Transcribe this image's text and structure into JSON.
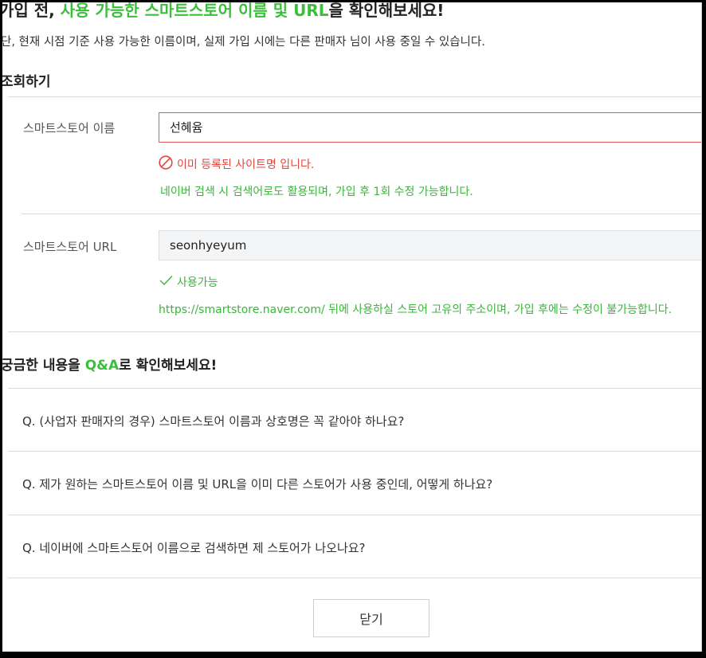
{
  "header": {
    "title_prefix": "가입 전, ",
    "title_highlight": "사용 가능한 스마트스토어 이름 및 URL",
    "title_suffix": "을 확인해보세요!",
    "notice": "단, 현재 시점 기준 사용 가능한 이름이며, 실제 가입 시에는 다른 판매자 님이 사용 중일 수 있습니다."
  },
  "lookup": {
    "heading": "조회하기",
    "name": {
      "label": "스마트스토어 이름",
      "value": "선혜윰",
      "error": "이미 등록된 사이트명 입니다.",
      "help": "네이버 검색 시 검색어로도 활용되며, 가입 후 1회 수정 가능합니다."
    },
    "url": {
      "label": "스마트스토어 URL",
      "value": "seonhyeyum",
      "status": "사용가능",
      "help": "https://smartstore.naver.com/ 뒤에 사용하실 스토어 고유의 주소이며, 가입 후에는 수정이 불가능합니다."
    }
  },
  "qa": {
    "heading_prefix": "궁금한 내용을 ",
    "heading_highlight": "Q&A",
    "heading_suffix": "로 확인해보세요!",
    "items": [
      "Q. (사업자 판매자의 경우) 스마트스토어 이름과 상호명은 꼭 같아야 하나요?",
      "Q. 제가 원하는 스마트스토어 이름 및 URL을 이미 다른 스토어가 사용 중인데, 어떻게 하나요?",
      "Q. 네이버에 스마트스토어 이름으로 검색하면 제 스토어가 나오나요?"
    ]
  },
  "footer": {
    "close_label": "닫기"
  },
  "colors": {
    "accent_green": "#3bbf3b",
    "error_red": "#e0463d",
    "border": "#dcdcdc"
  },
  "icons": {
    "error": "prohibited-icon",
    "ok": "checkmark-icon"
  }
}
